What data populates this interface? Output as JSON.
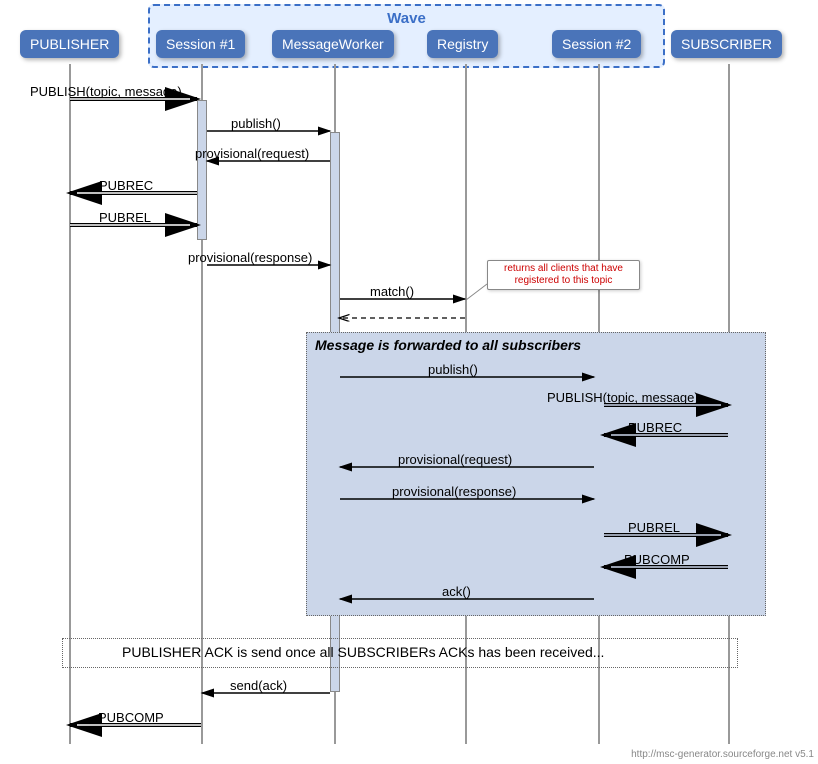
{
  "actors": {
    "publisher": "PUBLISHER",
    "session1": "Session #1",
    "msgworker": "MessageWorker",
    "registry": "Registry",
    "session2": "Session #2",
    "subscriber": "SUBSCRIBER"
  },
  "wave_title": "Wave",
  "messages": {
    "m1": "PUBLISH(topic, message)",
    "m2": "publish()",
    "m3": "provisional(request)",
    "m4": "PUBREC",
    "m5": "PUBREL",
    "m6": "provisional(response)",
    "m7": "match()",
    "m8": "publish()",
    "m9": "PUBLISH(topic, message)",
    "m10": "PUBREC",
    "m11": "provisional(request)",
    "m12": "provisional(response)",
    "m13": "PUBREL",
    "m14": "PUBCOMP",
    "m15": "ack()",
    "m16": "send(ack)",
    "m17": "PUBCOMP"
  },
  "opt_title": "Message is forwarded to all subscribers",
  "note": "returns all clients that have registered to this topic",
  "divider": "PUBLISHER ACK is send once all SUBSCRIBERs ACKs has been received...",
  "footer": "http://msc-generator.sourceforge.net v5.1",
  "chart_data": {
    "type": "sequence-diagram",
    "group": {
      "name": "Wave",
      "members": [
        "Session #1",
        "MessageWorker",
        "Registry",
        "Session #2"
      ]
    },
    "participants": [
      "PUBLISHER",
      "Session #1",
      "MessageWorker",
      "Registry",
      "Session #2",
      "SUBSCRIBER"
    ],
    "sequence": [
      {
        "from": "PUBLISHER",
        "to": "Session #1",
        "label": "PUBLISH(topic, message)",
        "style": "double"
      },
      {
        "from": "Session #1",
        "to": "MessageWorker",
        "label": "publish()"
      },
      {
        "from": "MessageWorker",
        "to": "Session #1",
        "label": "provisional(request)"
      },
      {
        "from": "Session #1",
        "to": "PUBLISHER",
        "label": "PUBREC",
        "style": "double"
      },
      {
        "from": "PUBLISHER",
        "to": "Session #1",
        "label": "PUBREL",
        "style": "double"
      },
      {
        "from": "Session #1",
        "to": "MessageWorker",
        "label": "provisional(response)"
      },
      {
        "from": "MessageWorker",
        "to": "Registry",
        "label": "match()",
        "note": "returns all clients that have registered to this topic"
      },
      {
        "from": "Registry",
        "to": "MessageWorker",
        "style": "dashed-return"
      },
      {
        "box": "Message is forwarded to all subscribers",
        "contents": [
          {
            "from": "MessageWorker",
            "to": "Session #2",
            "label": "publish()"
          },
          {
            "from": "Session #2",
            "to": "SUBSCRIBER",
            "label": "PUBLISH(topic, message)",
            "style": "double"
          },
          {
            "from": "SUBSCRIBER",
            "to": "Session #2",
            "label": "PUBREC",
            "style": "double"
          },
          {
            "from": "Session #2",
            "to": "MessageWorker",
            "label": "provisional(request)"
          },
          {
            "from": "MessageWorker",
            "to": "Session #2",
            "label": "provisional(response)"
          },
          {
            "from": "Session #2",
            "to": "SUBSCRIBER",
            "label": "PUBREL",
            "style": "double"
          },
          {
            "from": "SUBSCRIBER",
            "to": "Session #2",
            "label": "PUBCOMP",
            "style": "double"
          },
          {
            "from": "Session #2",
            "to": "MessageWorker",
            "label": "ack()"
          }
        ]
      },
      {
        "divider": "PUBLISHER ACK is send once all SUBSCRIBERs ACKs has been received..."
      },
      {
        "from": "MessageWorker",
        "to": "Session #1",
        "label": "send(ack)"
      },
      {
        "from": "Session #1",
        "to": "PUBLISHER",
        "label": "PUBCOMP",
        "style": "double"
      }
    ]
  }
}
